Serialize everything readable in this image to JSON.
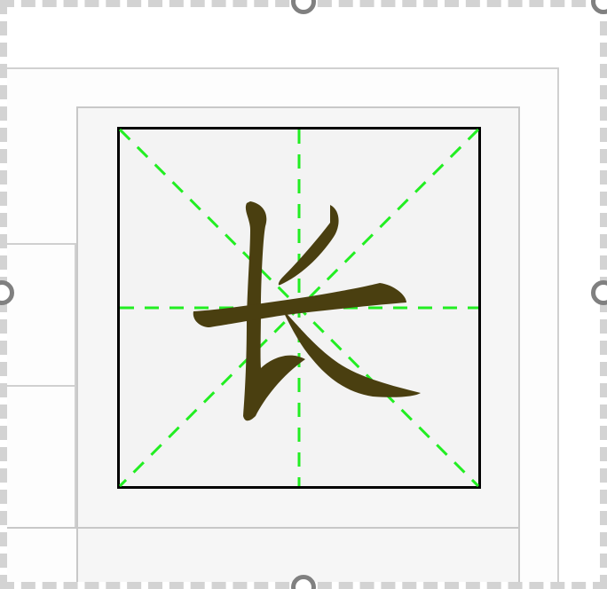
{
  "canvas": {
    "character": "长",
    "guide_line_color": "#22ee22",
    "character_color": "#4a3f10",
    "grid_border_color": "#000000",
    "handle_color": "#808080"
  },
  "selection": {
    "handles": [
      "top-handle",
      "left-handle",
      "right-handle",
      "bottom-handle"
    ]
  }
}
